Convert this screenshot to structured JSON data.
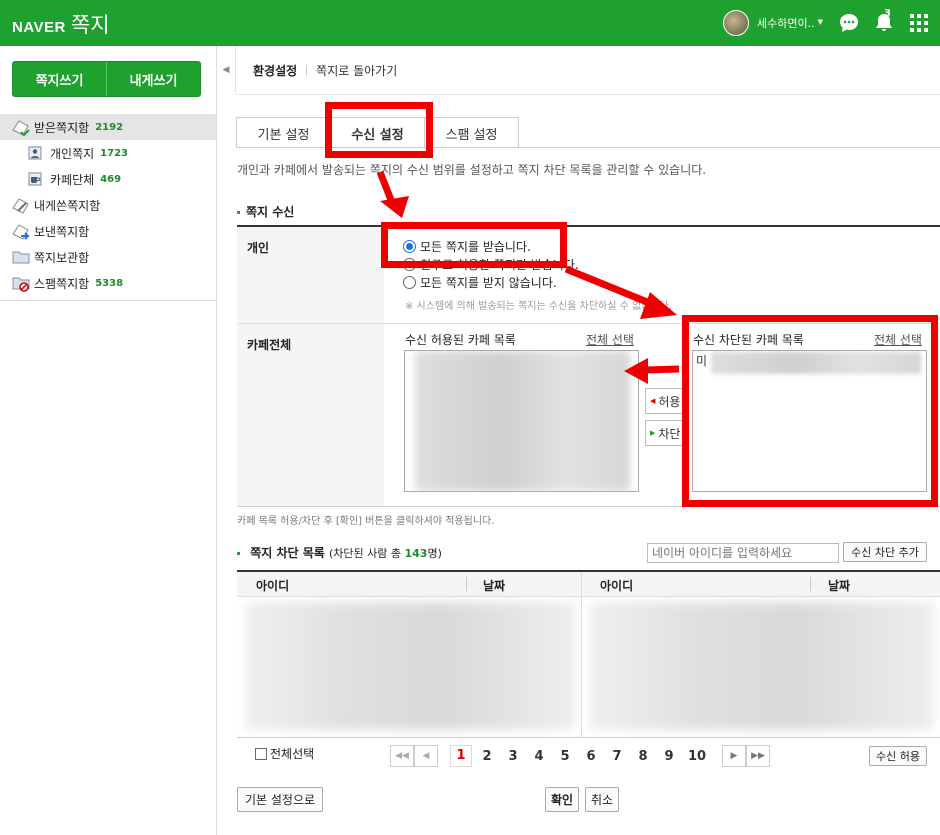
{
  "app": {
    "brand": "NAVER",
    "service": "쪽지",
    "user_name": "세수하면이..",
    "notification_count": "3",
    "brand_color": "#1fa12f"
  },
  "left": {
    "write_btn": "쪽지쓰기",
    "self_btn": "내게쓰기",
    "folders": [
      {
        "label": "받은쪽지함",
        "count": "2192",
        "icon": "inbox-icon"
      },
      {
        "label": "개인쪽지",
        "count": "1723",
        "icon": "person-icon"
      },
      {
        "label": "카페단체",
        "count": "469",
        "icon": "cafe-icon"
      },
      {
        "label": "내게쓴쪽지함",
        "count": "",
        "icon": "self-memo-icon"
      },
      {
        "label": "보낸쪽지함",
        "count": "",
        "icon": "sent-icon"
      },
      {
        "label": "쪽지보관함",
        "count": "",
        "icon": "archive-folder-icon"
      },
      {
        "label": "스팸쪽지함",
        "count": "5338",
        "icon": "spam-icon"
      }
    ]
  },
  "breadcrumb": {
    "current": "환경설정",
    "back": "쪽지로 돌아가기"
  },
  "tabs": [
    {
      "label": "기본 설정"
    },
    {
      "label": "수신 설정"
    },
    {
      "label": "스팸 설정"
    }
  ],
  "description": "개인과 카페에서 발송되는 쪽지의 수신 범위를 설정하고 쪽지 차단 목록을 관리할 수 있습니다.",
  "receive": {
    "title": "쪽지 수신",
    "personal_label": "개인",
    "options": [
      "모든 쪽지를 받습니다.",
      "친구로 허용한 쪽지만 받습니다.",
      "모든 쪽지를 받지 않습니다."
    ],
    "selected_option": 0,
    "note": "※ 시스템에 의해 발송되는 쪽지는 수신을 차단하실 수 없습니다.",
    "cafe_label": "카페전체",
    "allowed_title": "수신 허용된 카페 목록",
    "select_all": "전체 선택",
    "blocked_title": "수신 차단된 카페 목록",
    "allow_btn": "허용",
    "block_btn": "차단",
    "blocked_first": "미",
    "help": "카페 목록 허용/차단 후 [확인] 버튼을 클릭하셔야 적용됩니다."
  },
  "blocklist": {
    "title": "쪽지 차단 목록",
    "count_prefix": "(차단된 사람 총 ",
    "count": "143",
    "count_suffix": "명)",
    "input_placeholder": "네이버 아이디를 입력하세요",
    "add_btn": "수신 차단 추가",
    "col_id": "아이디",
    "col_date": "날짜",
    "select_all": "전체선택",
    "pages": [
      "1",
      "2",
      "3",
      "4",
      "5",
      "6",
      "7",
      "8",
      "9",
      "10"
    ],
    "current_page": "1",
    "allow_btn": "수신 허용"
  },
  "footer": {
    "reset": "기본 설정으로",
    "confirm": "확인",
    "cancel": "취소"
  }
}
